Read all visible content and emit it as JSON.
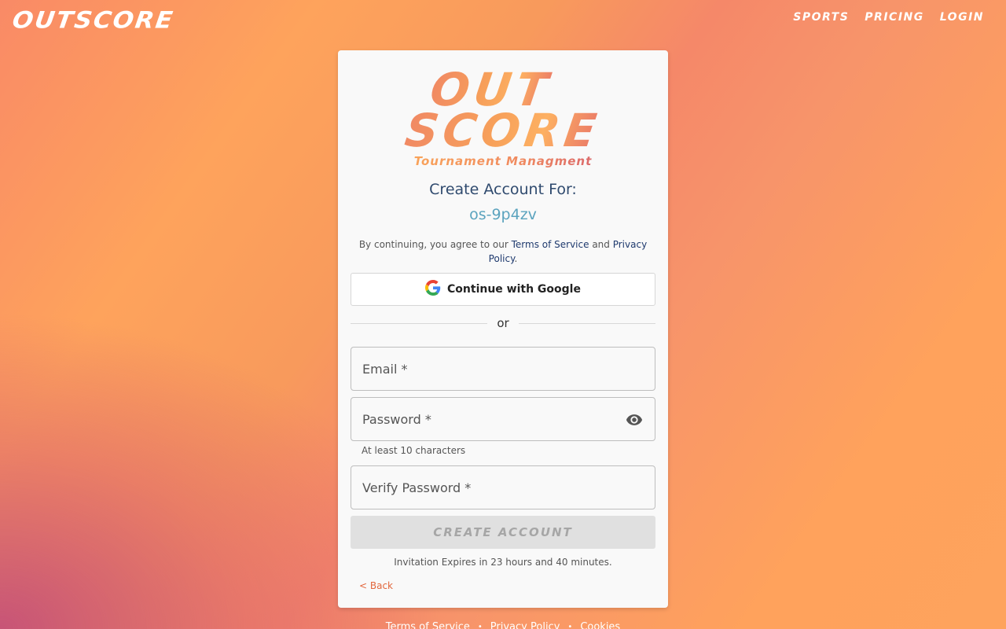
{
  "header": {
    "brand": "OUTSCORE",
    "nav": [
      "SPORTS",
      "PRICING",
      "LOGIN"
    ]
  },
  "card": {
    "logo_line1": "OUT",
    "logo_line2": "SCORE",
    "logo_tagline": "Tournament Managment",
    "heading": "Create Account For:",
    "org_id": "os-9p4zv",
    "terms_prefix": "By continuing, you agree to our ",
    "terms_link": "Terms of Service",
    "terms_and": " and ",
    "privacy_link": "Privacy Policy",
    "terms_suffix": ".",
    "google_button": "Continue with Google",
    "divider_text": "or",
    "email_label": "Email *",
    "password_label": "Password *",
    "password_helper": "At least 10 characters",
    "verify_label": "Verify Password *",
    "create_button": "CREATE ACCOUNT",
    "create_button_disabled": true,
    "expires_text": "Invitation Expires in 23 hours and 40 minutes.",
    "back_link": "< Back"
  },
  "footer": {
    "links": [
      "Terms of Service",
      "Privacy Policy",
      "Cookies"
    ],
    "separator": "•"
  },
  "colors": {
    "heading": "#2f4a6e",
    "org_id": "#5ba3be",
    "back_link": "#e2673d"
  },
  "icons": {
    "google": "google-icon",
    "password_toggle": "eye-icon"
  }
}
